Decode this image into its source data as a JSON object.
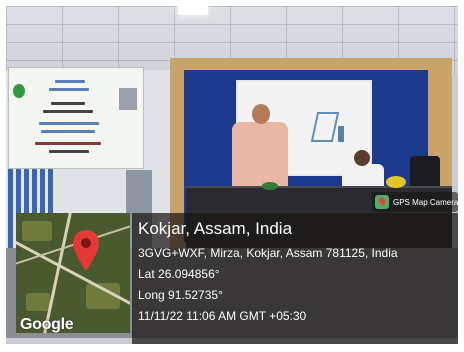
{
  "watermark": {
    "app_name": "GPS Map Camera",
    "brand_colors": {
      "caption_bg": "#191614",
      "pin": "#e53935",
      "icon_green": "#4caf6a"
    }
  },
  "location": {
    "place": "Kokjar, Assam, India",
    "address": "3GVG+WXF, Mirza, Kokjar, Assam 781125, India",
    "lat": "Lat 26.094856°",
    "long": "Long 91.52735°",
    "datetime": "11/11/22 11:06 AM GMT +05:30"
  },
  "map": {
    "provider": "Google",
    "marker_icon": "location-pin-icon"
  }
}
